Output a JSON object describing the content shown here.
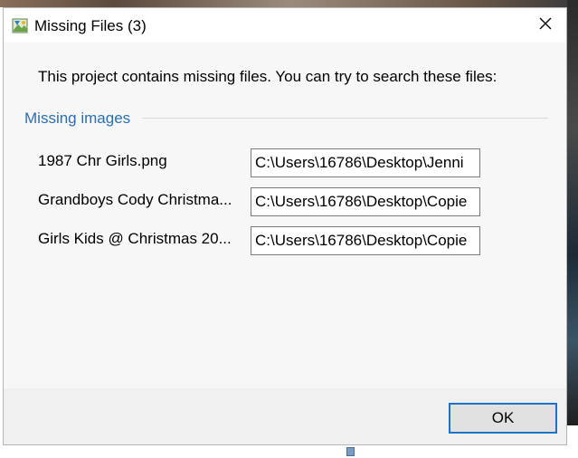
{
  "window": {
    "title": "Missing Files (3)",
    "close_icon": "close-icon",
    "app_icon": "image-map-app-icon"
  },
  "body": {
    "intro": "This project contains missing files. You can try to search these files:",
    "group_title": "Missing images"
  },
  "missing_files": [
    {
      "name": "1987 Chr Girls.png",
      "path": "C:\\Users\\16786\\Desktop\\Jenni"
    },
    {
      "name": "Grandboys  Cody Christma...",
      "path": "C:\\Users\\16786\\Desktop\\Copie"
    },
    {
      "name": "Girls  Kids @ Christmas 20...",
      "path": "C:\\Users\\16786\\Desktop\\Copie"
    }
  ],
  "footer": {
    "ok_label": "OK"
  },
  "colors": {
    "accent": "#1e73c8",
    "group_title": "#2a6fb0"
  }
}
